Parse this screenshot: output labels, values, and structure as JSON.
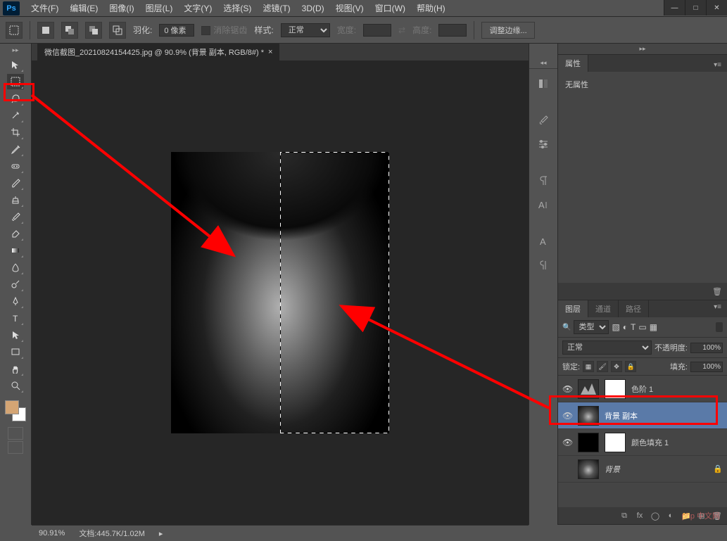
{
  "app": {
    "logo": "Ps"
  },
  "menu": {
    "file": "文件(F)",
    "edit": "编辑(E)",
    "image": "图像(I)",
    "layer": "图层(L)",
    "type": "文字(Y)",
    "select": "选择(S)",
    "filter": "滤镜(T)",
    "3d": "3D(D)",
    "view": "视图(V)",
    "window": "窗口(W)",
    "help": "帮助(H)"
  },
  "options": {
    "feather_label": "羽化:",
    "feather_value": "0 像素",
    "antialias": "消除锯齿",
    "style_label": "样式:",
    "style_value": "正常",
    "width_label": "宽度:",
    "height_label": "高度:",
    "refine_edge": "调整边缘..."
  },
  "document": {
    "tab_title": "微信截图_20210824154425.jpg @ 90.9% (背景 副本, RGB/8#) *"
  },
  "properties_panel": {
    "tab": "属性",
    "content": "无属性"
  },
  "layers_panel": {
    "tabs": {
      "layers": "图层",
      "channels": "通道",
      "paths": "路径"
    },
    "kind_label": "类型",
    "blend_mode": "正常",
    "opacity_label": "不透明度:",
    "opacity_value": "100%",
    "lock_label": "锁定:",
    "fill_label": "填充:",
    "fill_value": "100%",
    "layers": [
      {
        "name": "色阶 1",
        "visible": true,
        "type": "adjustment"
      },
      {
        "name": "背景 副本",
        "visible": true,
        "type": "image",
        "selected": true
      },
      {
        "name": "颜色填充 1",
        "visible": true,
        "type": "fill"
      },
      {
        "name": "背景",
        "visible": false,
        "type": "image",
        "locked": true,
        "italic": true
      }
    ]
  },
  "status": {
    "zoom": "90.91%",
    "doc_info": "文档:445.7K/1.02M"
  },
  "watermark": "php 中文网"
}
